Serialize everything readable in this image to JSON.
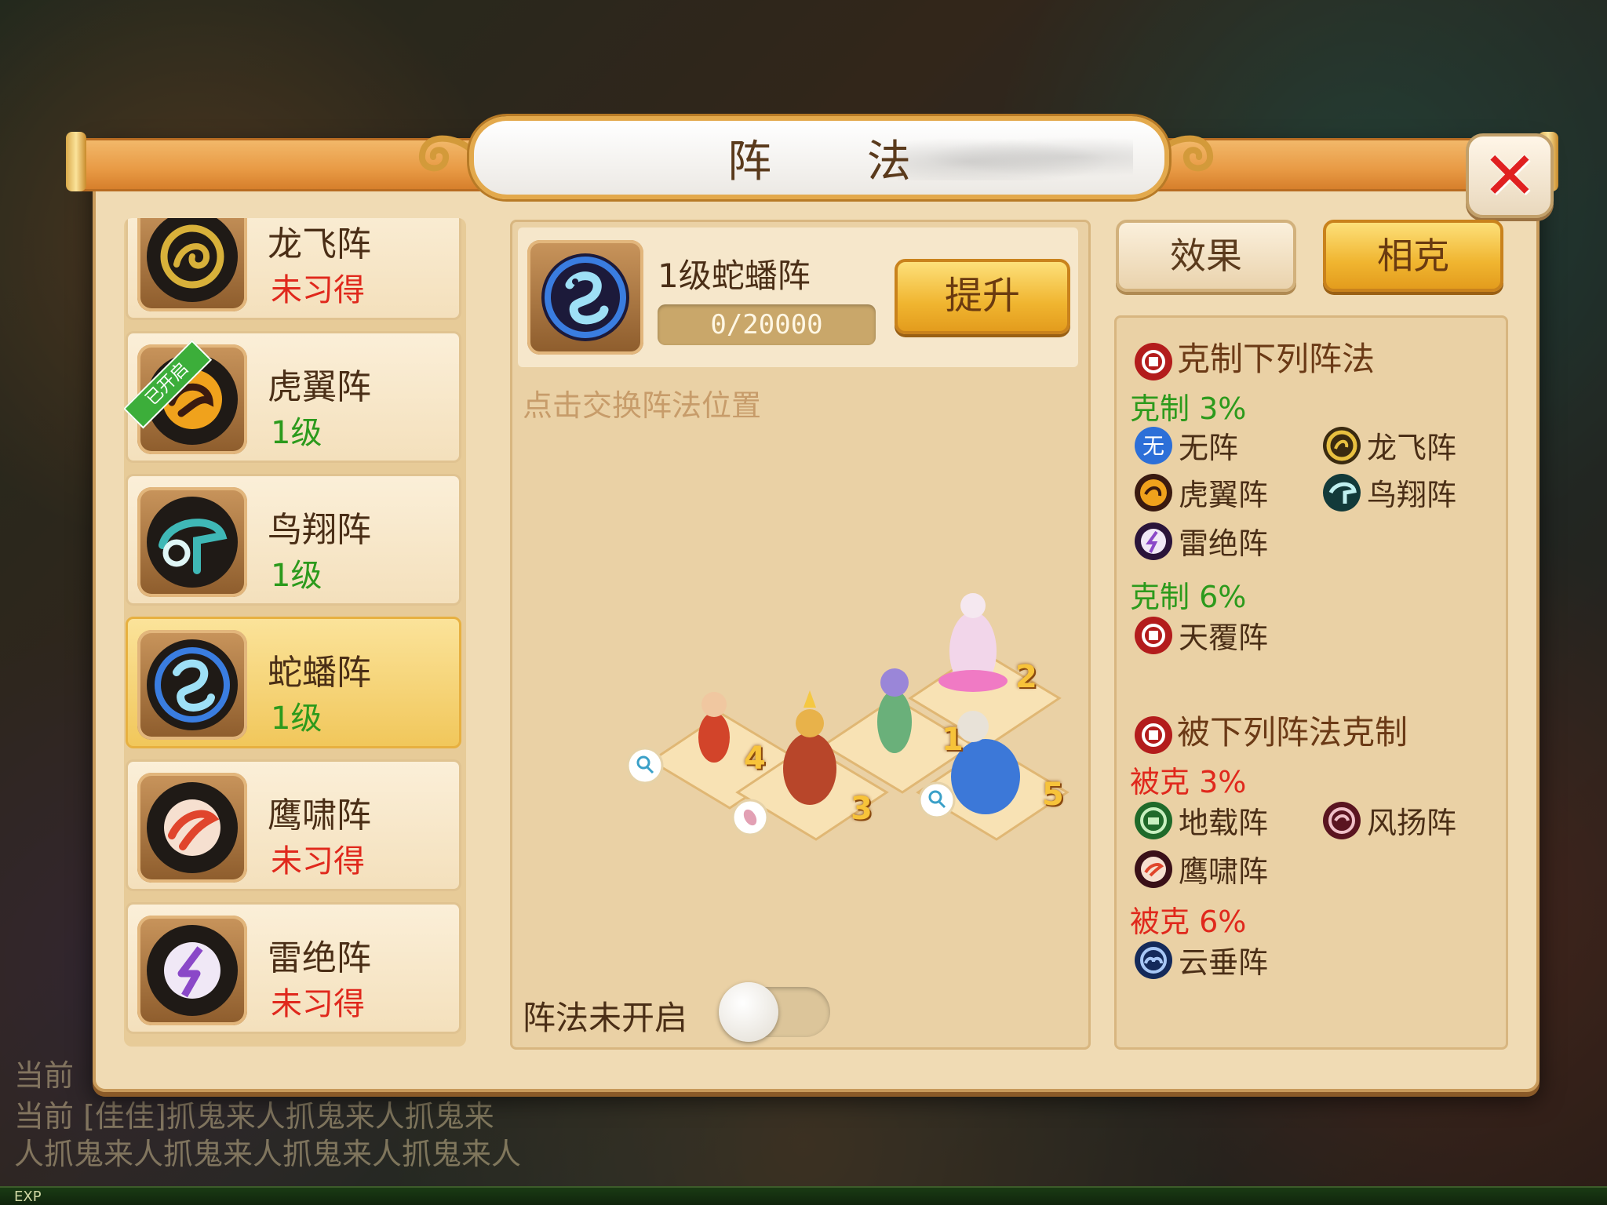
{
  "window": {
    "title": "阵 法",
    "close_icon": "close-icon"
  },
  "formation_list": [
    {
      "name": "龙飞阵",
      "status": "未习得",
      "learned": false,
      "icon": "dragon-emblem-icon",
      "color": "#d8b13a"
    },
    {
      "name": "虎翼阵",
      "status": "1级",
      "learned": true,
      "icon": "tiger-emblem-icon",
      "color": "#f0a21c",
      "badge": "已开启"
    },
    {
      "name": "鸟翔阵",
      "status": "1级",
      "learned": true,
      "icon": "bird-emblem-icon",
      "color": "#3fb8b6"
    },
    {
      "name": "蛇蟠阵",
      "status": "1级",
      "learned": true,
      "icon": "snake-emblem-icon",
      "color": "#3a7de0",
      "selected": true
    },
    {
      "name": "鹰啸阵",
      "status": "未习得",
      "learned": false,
      "icon": "eagle-emblem-icon",
      "color": "#e0452c"
    },
    {
      "name": "雷绝阵",
      "status": "未习得",
      "learned": false,
      "icon": "thunder-emblem-icon",
      "color": "#8a48c8"
    }
  ],
  "detail": {
    "level_name": "1级蛇蟠阵",
    "progress_text": "0/20000",
    "progress_fraction": 0,
    "upgrade_label": "提升",
    "hint": "点击交换阵法位置",
    "toggle_label": "阵法未开启",
    "toggle_on": false,
    "positions": [
      "1",
      "2",
      "3",
      "4",
      "5"
    ]
  },
  "tabs": {
    "effect_label": "效果",
    "counter_label": "相克",
    "active": "counter"
  },
  "counters": {
    "beats_heading": "克制下列阵法",
    "beats_groups": [
      {
        "label": "克制",
        "value": "3%",
        "items": [
          "无阵",
          "龙飞阵",
          "虎翼阵",
          "鸟翔阵",
          "雷绝阵"
        ]
      },
      {
        "label": "克制",
        "value": "6%",
        "items": [
          "天覆阵"
        ]
      }
    ],
    "beaten_heading": "被下列阵法克制",
    "beaten_groups": [
      {
        "label": "被克",
        "value": "3%",
        "items": [
          "地载阵",
          "风扬阵",
          "鹰啸阵"
        ]
      },
      {
        "label": "被克",
        "value": "6%",
        "items": [
          "云垂阵"
        ]
      }
    ]
  },
  "background": {
    "chat_lines": [
      "当前",
      "当前 [佳佳]抓鬼来人抓鬼来人抓鬼来",
      "人抓鬼来人抓鬼来人抓鬼来人抓鬼来人"
    ],
    "exp_label": "EXP"
  },
  "colors": {
    "accent_gold": "#f0b530",
    "learned_green": "#2c9a1c",
    "unlearned_red": "#e0281c"
  }
}
